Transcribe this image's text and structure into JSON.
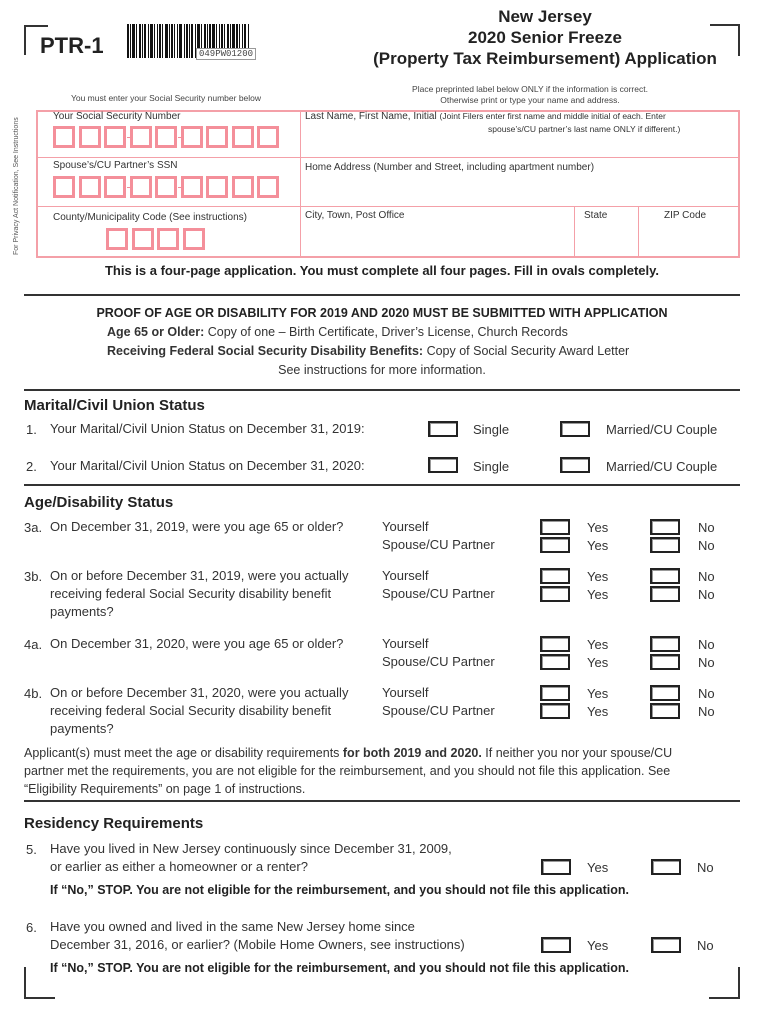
{
  "header": {
    "form_id": "PTR-1",
    "barcode_number": "049PW01200",
    "title_line1": "New Jersey",
    "title_line2": "2020 Senior Freeze",
    "title_line3": "(Property Tax Reimbursement) Application",
    "ssn_note": "You must enter your Social Security number below",
    "label_note_line1": "Place preprinted label below ONLY if the information is correct.",
    "label_note_line2": "Otherwise print or type your name and address.",
    "privacy_note": "For Privacy Act Notification, See Instructions"
  },
  "id_fields": {
    "your_ssn_label": "Your Social Security Number",
    "spouse_ssn_label": "Spouse’s/CU Partner’s SSN",
    "county_code_label": "County/Municipality Code (See instructions)",
    "name_label": "Last Name, First Name, Initial",
    "name_note_line1": "(Joint Filers enter first name and middle initial of each. Enter",
    "name_note_line2": "spouse’s/CU partner’s last name ONLY if different.)",
    "address_label": "Home Address (Number and Street, including apartment number)",
    "city_label": "City, Town, Post Office",
    "state_label": "State",
    "zip_label": "ZIP Code"
  },
  "four_page_notice": "This is a four-page application. You must complete all four pages. Fill in ovals completely.",
  "proof": {
    "heading": "PROOF OF AGE OR DISABILITY FOR 2019 AND 2020 MUST BE SUBMITTED WITH APPLICATION",
    "age_label": "Age 65 or Older:",
    "age_text": " Copy of one – Birth Certificate, Driver’s License, Church Records",
    "disability_label": "Receiving Federal Social Security Disability Benefits:",
    "disability_text": " Copy of Social Security Award Letter",
    "see_instructions": "See instructions for more information."
  },
  "marital": {
    "heading": "Marital/Civil Union Status",
    "questions": [
      {
        "num": "1.",
        "text": "Your Marital/Civil Union Status on December 31, 2019:",
        "opt1": "Single",
        "opt2": "Married/CU Couple"
      },
      {
        "num": "2.",
        "text": "Your Marital/Civil Union Status on December 31, 2020:",
        "opt1": "Single",
        "opt2": "Married/CU Couple"
      }
    ]
  },
  "age": {
    "heading": "Age/Disability Status",
    "yourself": "Yourself",
    "spouse": "Spouse/CU Partner",
    "yes": "Yes",
    "no": "No",
    "questions": [
      {
        "num": "3a.",
        "line1": "On December 31, 2019, were you age 65 or older?",
        "line2": "",
        "line3": ""
      },
      {
        "num": "3b.",
        "line1": "On or before December 31, 2019, were you actually",
        "line2": "receiving federal Social Security disability benefit",
        "line3": "payments?"
      },
      {
        "num": "4a.",
        "line1": "On December 31, 2020, were you age 65 or older?",
        "line2": "",
        "line3": ""
      },
      {
        "num": "4b.",
        "line1": "On or before December 31, 2020, were you actually",
        "line2": "receiving federal Social Security disability benefit",
        "line3": "payments?"
      }
    ],
    "note_part1": "Applicant(s) must meet the age or disability requirements ",
    "note_bold": "for both 2019 and 2020.",
    "note_part2": " If neither you nor your spouse/CU",
    "note_line2": "partner met the requirements, you are not eligible for the reimbursement, and you should not file this application. See",
    "note_line3": "“Eligibility Requirements” on page 1 of instructions."
  },
  "residency": {
    "heading": "Residency Requirements",
    "yes": "Yes",
    "no": "No",
    "q5_num": "5.",
    "q5_line1": "Have you lived in New Jersey continuously since December 31, 2009,",
    "q5_line2": "or earlier as either a homeowner or a renter?",
    "q6_num": "6.",
    "q6_line1": "Have you owned and lived in the same New Jersey home since",
    "q6_line2": "December 31, 2016, or earlier? (Mobile Home Owners, see instructions)",
    "stop_note": "If “No,” STOP. You are not eligible for the reimbursement, and you should not file this application."
  }
}
